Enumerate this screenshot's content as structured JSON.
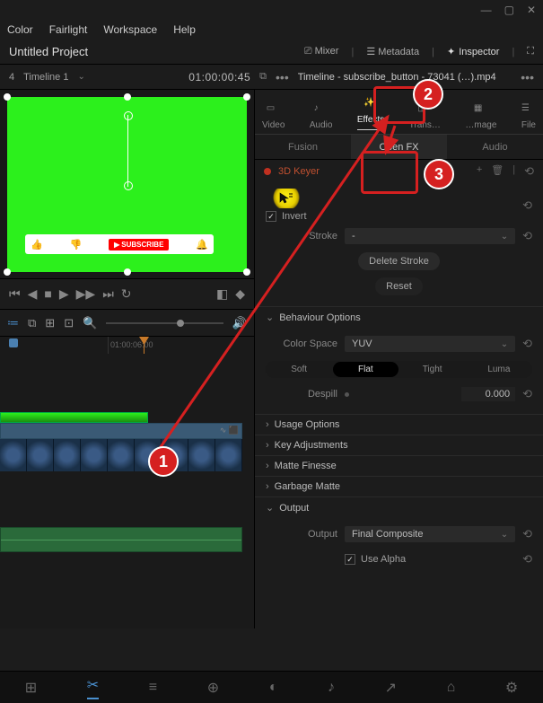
{
  "window": {
    "min": "—",
    "max": "▢",
    "close": "✕"
  },
  "menu": [
    "Color",
    "Fairlight",
    "Workspace",
    "Help"
  ],
  "project_title": "Untitled Project",
  "top_tools": {
    "mixer": "Mixer",
    "metadata": "Metadata",
    "inspector": "Inspector"
  },
  "timeline_row": {
    "left_num": "4",
    "timeline_name": "Timeline 1",
    "timecode": "01:00:00:45",
    "clip_name": "Timeline - subscribe_button - 73041 (…).mp4"
  },
  "inspector_tabs": [
    "Video",
    "Audio",
    "Effects",
    "Trans…",
    "…mage",
    "File"
  ],
  "inspector_subtabs": [
    "Fusion",
    "Open FX",
    "Audio"
  ],
  "effect": {
    "name": "3D Keyer",
    "invert": "Invert",
    "stroke_label": "Stroke",
    "delete_stroke": "Delete Stroke",
    "reset": "Reset"
  },
  "behaviour": {
    "title": "Behaviour Options",
    "color_space_label": "Color Space",
    "color_space": "YUV",
    "pills": [
      "Soft",
      "Flat",
      "Tight",
      "Luma"
    ],
    "despill_label": "Despill",
    "despill": "0.000"
  },
  "sections": [
    "Usage Options",
    "Key Adjustments",
    "Matte Finesse",
    "Garbage Matte"
  ],
  "output": {
    "title": "Output",
    "label": "Output",
    "value": "Final Composite",
    "use_alpha": "Use Alpha"
  },
  "ruler_tc": "01:00:06:00",
  "subscribe_btn": "SUBSCRIBE",
  "callouts": {
    "1": "1",
    "2": "2",
    "3": "3"
  }
}
